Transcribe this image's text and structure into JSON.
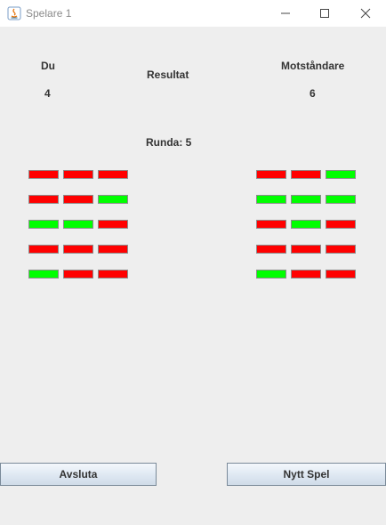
{
  "window": {
    "title": "Spelare 1"
  },
  "player": {
    "label": "Du",
    "score": "4"
  },
  "result_label": "Resultat",
  "opponent": {
    "label": "Motståndare",
    "score": "6"
  },
  "round": "Runda: 5",
  "colors": {
    "correct": "#00ff00",
    "wrong": "#ff0000"
  },
  "player_rounds": [
    [
      "wrong",
      "wrong",
      "wrong"
    ],
    [
      "wrong",
      "wrong",
      "correct"
    ],
    [
      "correct",
      "correct",
      "wrong"
    ],
    [
      "wrong",
      "wrong",
      "wrong"
    ],
    [
      "correct",
      "wrong",
      "wrong"
    ]
  ],
  "opponent_rounds": [
    [
      "wrong",
      "wrong",
      "correct"
    ],
    [
      "correct",
      "correct",
      "correct"
    ],
    [
      "wrong",
      "correct",
      "wrong"
    ],
    [
      "wrong",
      "wrong",
      "wrong"
    ],
    [
      "correct",
      "wrong",
      "wrong"
    ]
  ],
  "buttons": {
    "quit": "Avsluta",
    "new_game": "Nytt Spel"
  }
}
